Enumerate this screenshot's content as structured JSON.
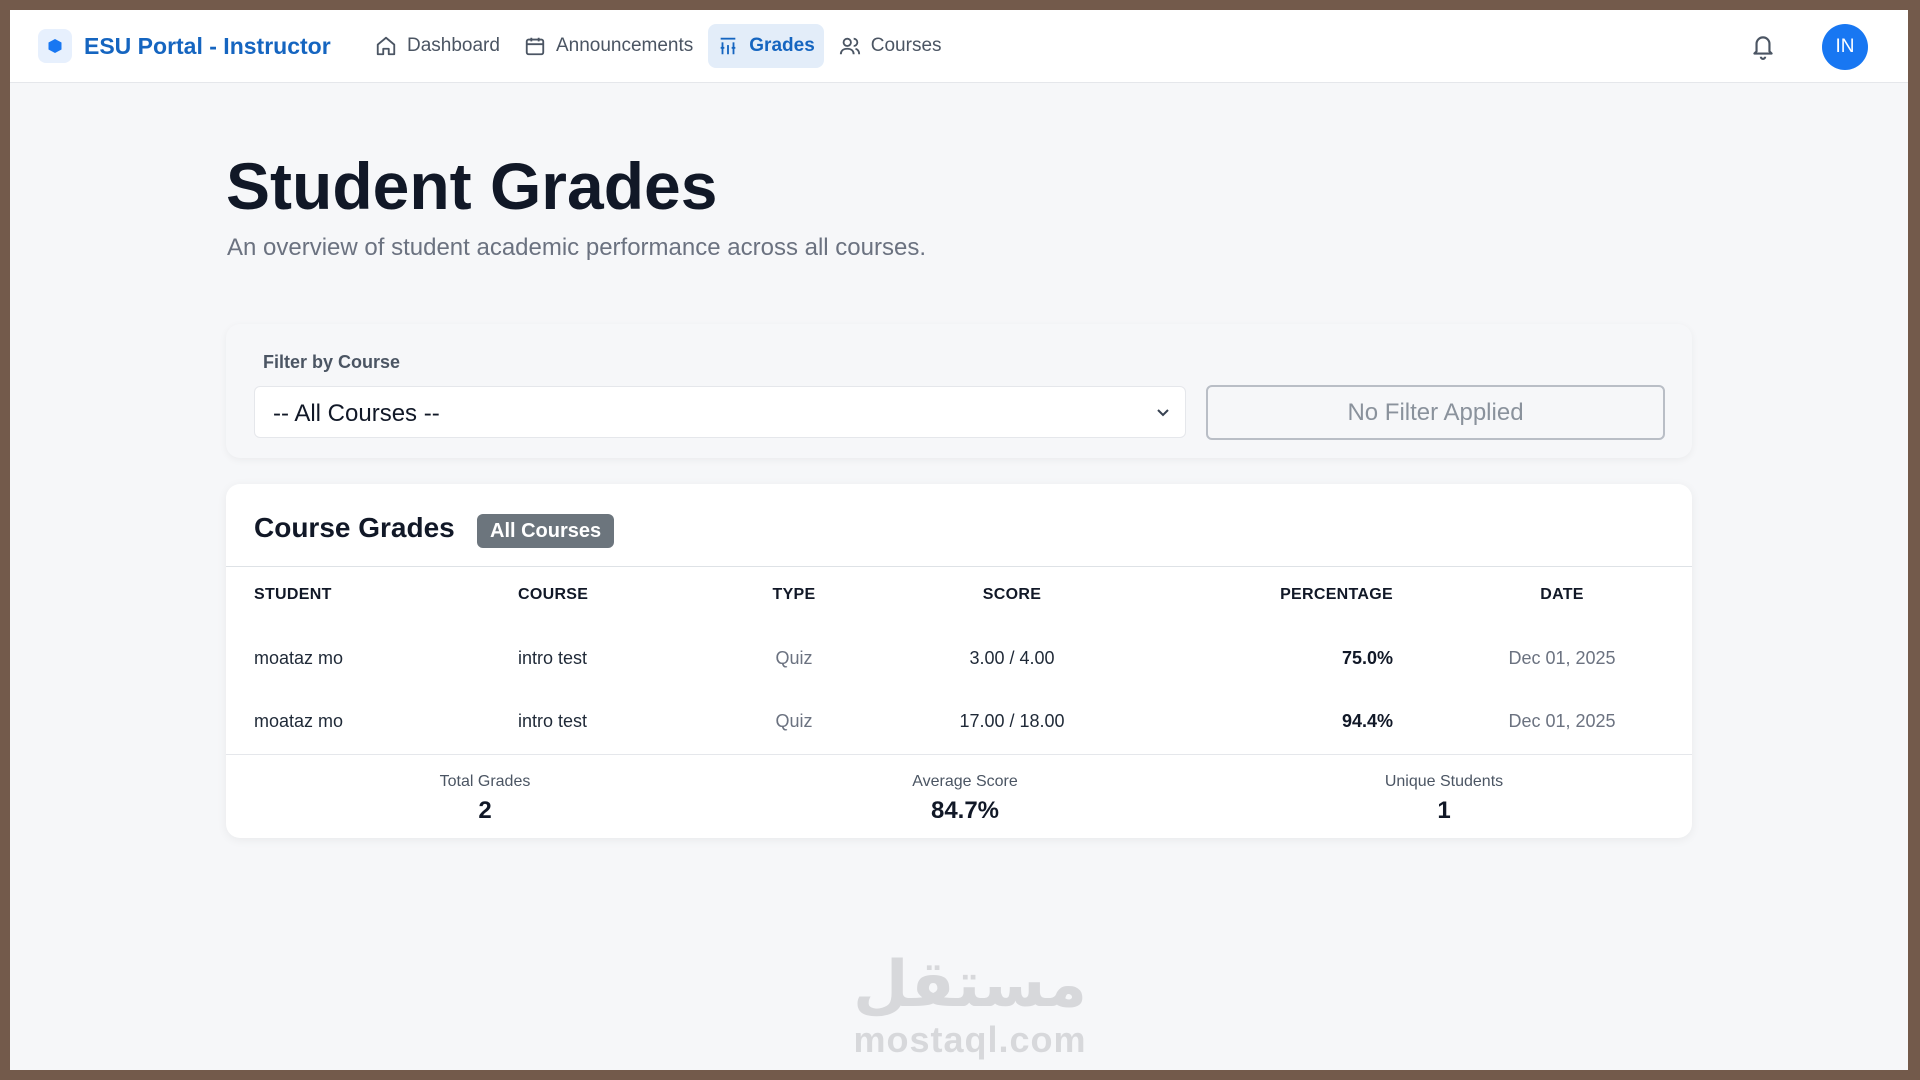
{
  "app": {
    "title": "ESU Portal - Instructor",
    "accent_color": "#1565c0",
    "brand_icon": "hexagon-icon"
  },
  "nav": {
    "items": [
      {
        "label": "Dashboard",
        "icon": "home-icon",
        "active": false
      },
      {
        "label": "Announcements",
        "icon": "calendar-icon",
        "active": false
      },
      {
        "label": "Grades",
        "icon": "chart-icon",
        "active": true
      },
      {
        "label": "Courses",
        "icon": "users-icon",
        "active": false
      }
    ],
    "notification_icon": "bell-icon",
    "avatar_initials": "IN"
  },
  "header": {
    "title": "Student Grades",
    "subtitle": "An overview of student academic performance across all courses."
  },
  "filter": {
    "label": "Filter by Course",
    "selected": "-- All Courses --",
    "status": "No Filter Applied"
  },
  "grades": {
    "title": "Course Grades",
    "badge": "All Courses",
    "columns": [
      "STUDENT",
      "COURSE",
      "TYPE",
      "SCORE",
      "PERCENTAGE",
      "DATE"
    ],
    "rows": [
      {
        "student": "moataz mo",
        "course": "intro test",
        "type": "Quiz",
        "score": "3.00 / 4.00",
        "percentage": "75.0%",
        "date": "Dec 01, 2025"
      },
      {
        "student": "moataz mo",
        "course": "intro test",
        "type": "Quiz",
        "score": "17.00 / 18.00",
        "percentage": "94.4%",
        "date": "Dec 01, 2025"
      }
    ],
    "stats": [
      {
        "label": "Total Grades",
        "value": "2"
      },
      {
        "label": "Average Score",
        "value": "84.7%"
      },
      {
        "label": "Unique Students",
        "value": "1"
      }
    ]
  },
  "watermark": {
    "arabic": "مستقل",
    "latin": "mostaql.com"
  }
}
